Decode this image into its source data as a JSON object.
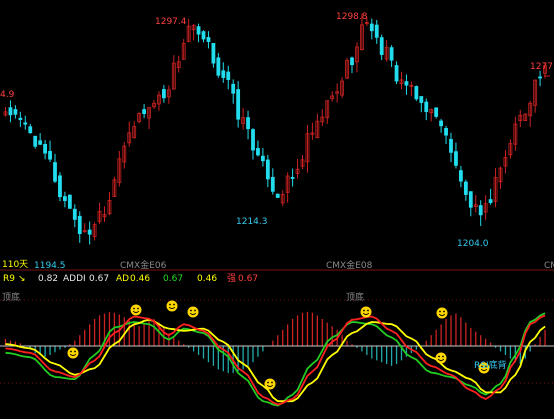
{
  "colors": {
    "background": "#000000",
    "up_candle": "#cc2222",
    "down_candle": "#22ddee",
    "k_line": "#ff2020",
    "d_line": "#ffff00",
    "j_line": "#22cc22",
    "bar_pos": "#cc2222",
    "bar_neg": "#22aaaa",
    "zero_line": "#c8c8c8",
    "smiley": "#ffd700"
  },
  "main_panel": {
    "period_label": "110天",
    "contract_labels": [
      "CMX金E06",
      "CMX金E08",
      "CM"
    ],
    "price_labels": {
      "left_edge": "4.9",
      "high_1": "1297.4",
      "high_2": "1298.8",
      "high_3": "1277",
      "low_0": "1194.5",
      "low_1": "1214.3",
      "low_2": "1204.0"
    }
  },
  "indicator_panel": {
    "name": "R9",
    "name_arrow": "↘",
    "value_1": "0.82",
    "addi_label": "ADDI",
    "addi_value": "0.67",
    "ad_label": "AD",
    "ad_value": "0.46",
    "green_value": "0.67",
    "yellow_value": "0.46",
    "strong_label": "强",
    "strong_value": "0.67",
    "top_div_label_left": "顶底",
    "top_div_label_mid": "顶底",
    "rsi_div_label": "RSI底背"
  },
  "chart_data": [
    {
      "type": "candlestick",
      "x_count": 110,
      "ylim": [
        1190,
        1300
      ],
      "annotations": [
        {
          "text": "1194.5",
          "value": 1194.5
        },
        {
          "text": "1297.4",
          "value": 1297.4
        },
        {
          "text": "1214.3",
          "value": 1214.3
        },
        {
          "text": "1298.8",
          "value": 1298.8
        },
        {
          "text": "1204.0",
          "value": 1204.0
        },
        {
          "text": "1277",
          "value": 1277
        }
      ],
      "close_anchors": [
        [
          0,
          1255
        ],
        [
          4,
          1248
        ],
        [
          8,
          1235
        ],
        [
          12,
          1215
        ],
        [
          16,
          1200
        ],
        [
          20,
          1212
        ],
        [
          24,
          1240
        ],
        [
          28,
          1255
        ],
        [
          32,
          1262
        ],
        [
          35,
          1278
        ],
        [
          37,
          1292
        ],
        [
          40,
          1285
        ],
        [
          44,
          1270
        ],
        [
          48,
          1250
        ],
        [
          52,
          1230
        ],
        [
          55,
          1218
        ],
        [
          58,
          1225
        ],
        [
          62,
          1245
        ],
        [
          66,
          1260
        ],
        [
          70,
          1278
        ],
        [
          73,
          1295
        ],
        [
          76,
          1282
        ],
        [
          80,
          1268
        ],
        [
          84,
          1258
        ],
        [
          88,
          1250
        ],
        [
          91,
          1230
        ],
        [
          94,
          1210
        ],
        [
          97,
          1212
        ],
        [
          100,
          1230
        ],
        [
          104,
          1252
        ],
        [
          108,
          1270
        ],
        [
          109,
          1272
        ]
      ]
    },
    {
      "type": "line",
      "x_count": 110,
      "ylim": [
        0,
        1
      ],
      "series": [
        {
          "name": "K",
          "anchors": [
            [
              0,
              0.56
            ],
            [
              5,
              0.52
            ],
            [
              10,
              0.35
            ],
            [
              14,
              0.3
            ],
            [
              18,
              0.45
            ],
            [
              22,
              0.7
            ],
            [
              26,
              0.85
            ],
            [
              29,
              0.83
            ],
            [
              33,
              0.68
            ],
            [
              36,
              0.78
            ],
            [
              40,
              0.72
            ],
            [
              44,
              0.55
            ],
            [
              48,
              0.35
            ],
            [
              52,
              0.12
            ],
            [
              55,
              0.05
            ],
            [
              58,
              0.1
            ],
            [
              62,
              0.35
            ],
            [
              66,
              0.62
            ],
            [
              70,
              0.82
            ],
            [
              74,
              0.85
            ],
            [
              78,
              0.72
            ],
            [
              82,
              0.55
            ],
            [
              86,
              0.4
            ],
            [
              90,
              0.32
            ],
            [
              94,
              0.18
            ],
            [
              97,
              0.1
            ],
            [
              100,
              0.2
            ],
            [
              103,
              0.45
            ],
            [
              106,
              0.78
            ],
            [
              109,
              0.86
            ]
          ]
        },
        {
          "name": "D",
          "anchors": [
            [
              0,
              0.6
            ],
            [
              5,
              0.56
            ],
            [
              10,
              0.42
            ],
            [
              14,
              0.32
            ],
            [
              18,
              0.38
            ],
            [
              22,
              0.6
            ],
            [
              26,
              0.78
            ],
            [
              29,
              0.82
            ],
            [
              33,
              0.74
            ],
            [
              36,
              0.72
            ],
            [
              40,
              0.74
            ],
            [
              44,
              0.62
            ],
            [
              48,
              0.42
            ],
            [
              52,
              0.22
            ],
            [
              55,
              0.08
            ],
            [
              58,
              0.08
            ],
            [
              62,
              0.25
            ],
            [
              66,
              0.5
            ],
            [
              70,
              0.7
            ],
            [
              74,
              0.8
            ],
            [
              78,
              0.78
            ],
            [
              82,
              0.65
            ],
            [
              86,
              0.48
            ],
            [
              90,
              0.36
            ],
            [
              94,
              0.28
            ],
            [
              97,
              0.16
            ],
            [
              100,
              0.16
            ],
            [
              103,
              0.32
            ],
            [
              106,
              0.62
            ],
            [
              109,
              0.76
            ]
          ]
        },
        {
          "name": "J",
          "anchors": [
            [
              0,
              0.52
            ],
            [
              5,
              0.48
            ],
            [
              10,
              0.3
            ],
            [
              14,
              0.28
            ],
            [
              18,
              0.5
            ],
            [
              22,
              0.75
            ],
            [
              26,
              0.8
            ],
            [
              29,
              0.78
            ],
            [
              33,
              0.64
            ],
            [
              36,
              0.74
            ],
            [
              40,
              0.7
            ],
            [
              44,
              0.52
            ],
            [
              48,
              0.3
            ],
            [
              52,
              0.08
            ],
            [
              55,
              0.04
            ],
            [
              58,
              0.14
            ],
            [
              62,
              0.42
            ],
            [
              66,
              0.66
            ],
            [
              70,
              0.8
            ],
            [
              74,
              0.78
            ],
            [
              78,
              0.66
            ],
            [
              82,
              0.48
            ],
            [
              86,
              0.34
            ],
            [
              90,
              0.3
            ],
            [
              94,
              0.22
            ],
            [
              97,
              0.14
            ],
            [
              100,
              0.24
            ],
            [
              103,
              0.5
            ],
            [
              106,
              0.8
            ],
            [
              109,
              0.88
            ]
          ]
        }
      ],
      "bars": [
        0.08,
        0.06,
        0.05,
        0.03,
        0.0,
        -0.04,
        -0.08,
        -0.1,
        -0.12,
        -0.1,
        -0.07,
        -0.04,
        -0.02,
        0.02,
        0.06,
        0.12,
        0.18,
        0.24,
        0.3,
        0.34,
        0.36,
        0.38,
        0.37,
        0.35,
        0.32,
        0.28,
        0.24,
        0.22,
        0.25,
        0.28,
        0.3,
        0.26,
        0.2,
        0.14,
        0.1,
        0.06,
        0.02,
        -0.02,
        -0.06,
        -0.1,
        -0.14,
        -0.18,
        -0.22,
        -0.26,
        -0.28,
        -0.3,
        -0.3,
        -0.28,
        -0.26,
        -0.22,
        -0.18,
        -0.12,
        -0.06,
        0.0,
        0.06,
        0.12,
        0.18,
        0.24,
        0.3,
        0.34,
        0.37,
        0.38,
        0.37,
        0.34,
        0.3,
        0.26,
        0.22,
        0.18,
        0.12,
        0.06,
        0.02,
        -0.02,
        -0.06,
        -0.1,
        -0.14,
        -0.16,
        -0.18,
        -0.2,
        -0.22,
        -0.2,
        -0.16,
        -0.12,
        -0.08,
        -0.04,
        0.0,
        0.06,
        0.12,
        0.18,
        0.24,
        0.3,
        0.34,
        0.36,
        0.32,
        0.26,
        0.2,
        0.16,
        0.12,
        0.08,
        0.04,
        -0.02,
        -0.06,
        -0.1,
        -0.14,
        -0.18,
        -0.2,
        -0.14,
        -0.06,
        0.02,
        0.1,
        0.18
      ],
      "markers": [
        {
          "x": 24,
          "y": 0.28
        },
        {
          "x": 43,
          "y": 0.18
        },
        {
          "x": 86,
          "y": 0.3
        }
      ]
    }
  ]
}
